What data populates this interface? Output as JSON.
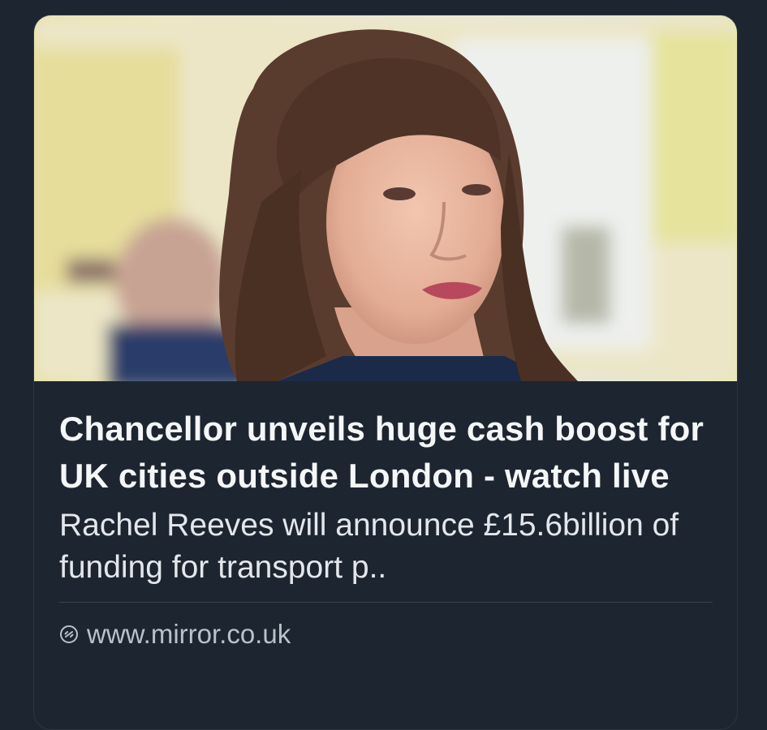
{
  "card": {
    "image_alt": "Photo of Rachel Reeves",
    "headline": "Chancellor unveils huge cash boost for UK cities outside London - watch live",
    "description": "Rachel Reeves will announce £15.6billion of funding for transport p..",
    "source": {
      "icon": "link-icon",
      "domain": "www.mirror.co.uk"
    }
  },
  "colors": {
    "background": "#1d2530",
    "headline": "#f4f6f8",
    "description": "#e3e7ec",
    "source": "#b9c1ca",
    "divider": "#394553"
  }
}
